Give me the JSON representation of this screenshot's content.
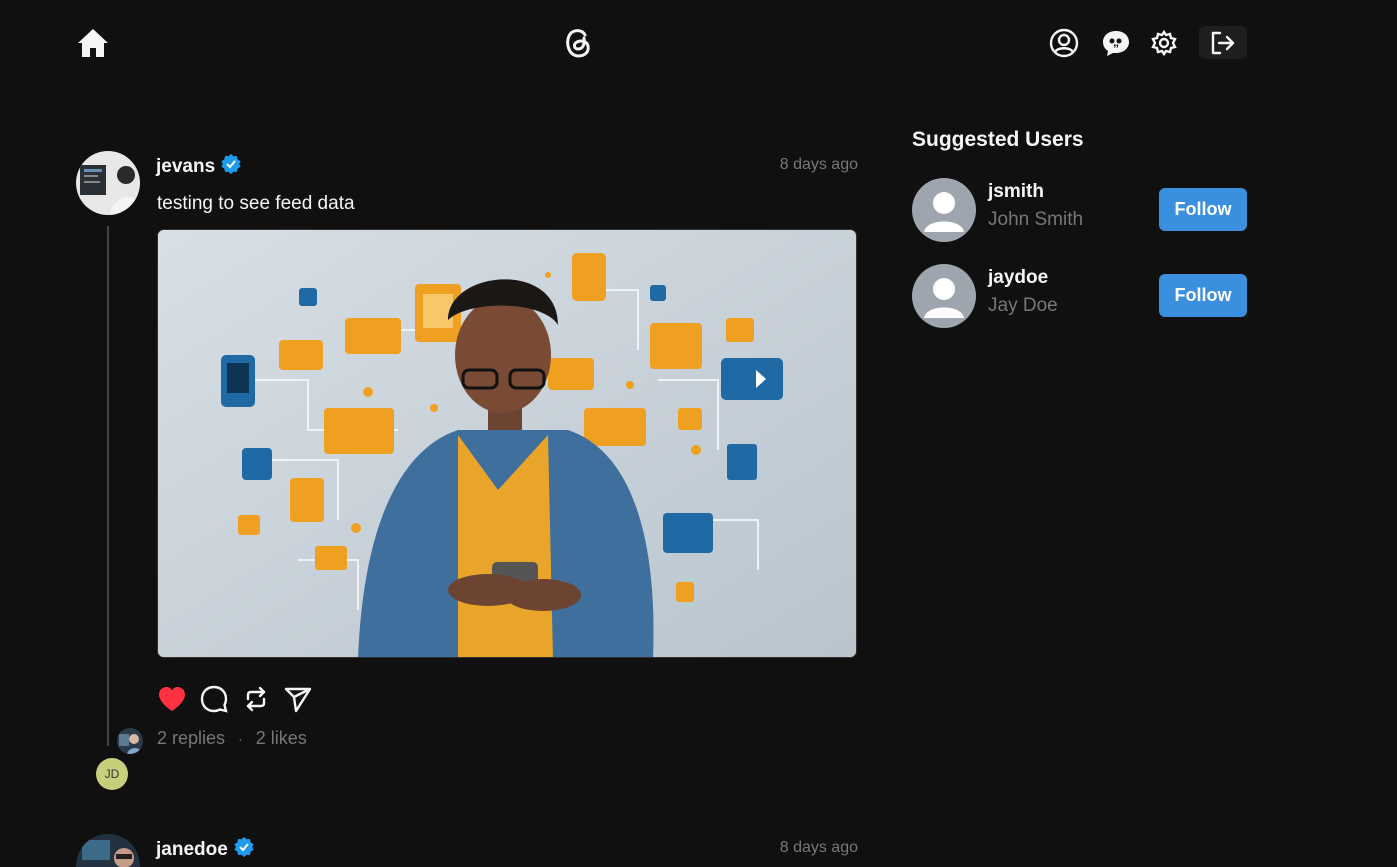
{
  "nav": {
    "home_icon": "home-icon",
    "logo_icon": "threads-logo-icon",
    "profile_icon": "user-circle-icon",
    "chat_icon": "chat-icon",
    "settings_icon": "gear-icon",
    "logout_icon": "logout-icon"
  },
  "posts": [
    {
      "username": "jevans",
      "verified": true,
      "time": "8 days ago",
      "text": "testing to see feed data",
      "liked": true,
      "replies": "2 replies",
      "separator": "·",
      "likes": "2 likes",
      "reply_initials": "JD"
    },
    {
      "username": "janedoe",
      "verified": true,
      "time": "8 days ago"
    }
  ],
  "sidebar": {
    "title": "Suggested Users",
    "users": [
      {
        "username": "jsmith",
        "name": "John Smith",
        "button": "Follow"
      },
      {
        "username": "jaydoe",
        "name": "Jay Doe",
        "button": "Follow"
      }
    ]
  },
  "colors": {
    "background": "#101010",
    "accent": "#3a8fdf",
    "like": "#ff3040",
    "verified": "#1d9bf0"
  }
}
